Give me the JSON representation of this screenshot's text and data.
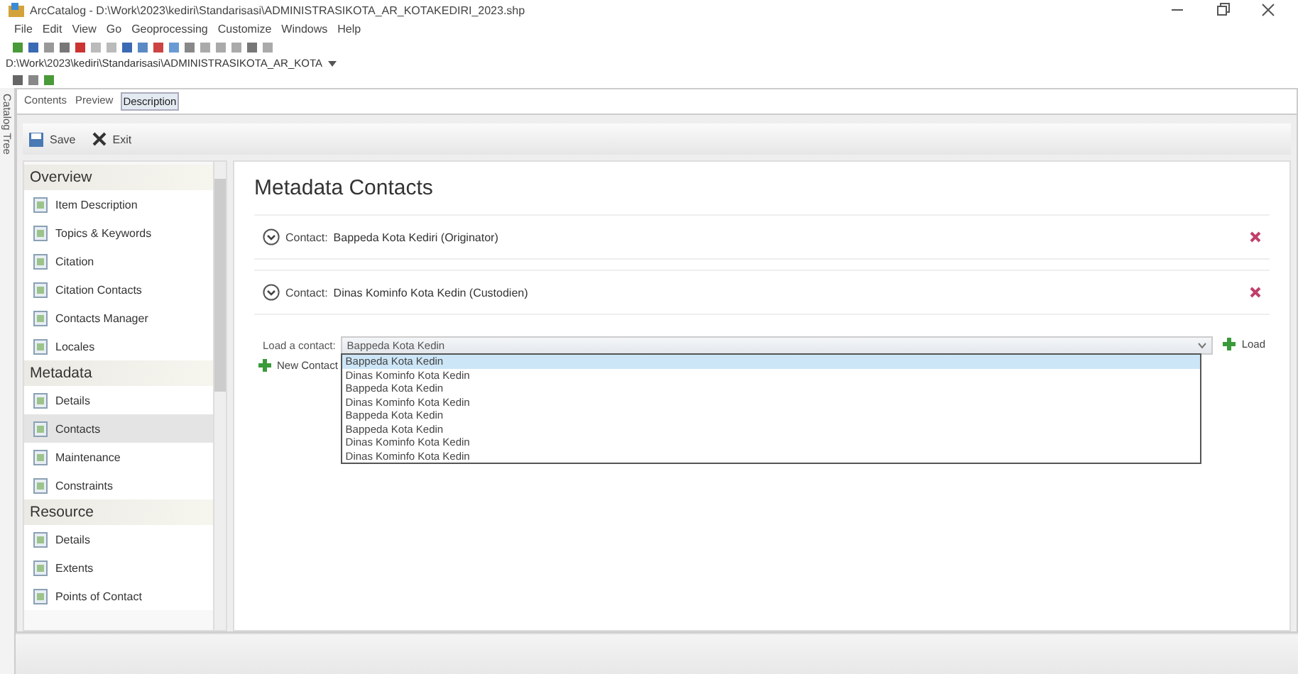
{
  "window": {
    "title": "ArcCatalog - D:\\Work\\2023\\kediri\\Standarisasi\\ADMINISTRASIKOTA_AR_KOTAKEDIRI_2023.shp"
  },
  "menu": [
    "File",
    "Edit",
    "View",
    "Go",
    "Geoprocessing",
    "Customize",
    "Windows",
    "Help"
  ],
  "location": {
    "value": "D:\\Work\\2023\\kediri\\Standarisasi\\ADMINISTRASIKOTA_AR_KOTA"
  },
  "side_tab": "Catalog Tree",
  "tabs": [
    {
      "label": "Contents",
      "selected": false
    },
    {
      "label": "Preview",
      "selected": false
    },
    {
      "label": "Description",
      "selected": true
    }
  ],
  "actions": [
    "Save",
    "Exit"
  ],
  "sidebar": [
    {
      "heading": "Overview",
      "items": [
        {
          "label": "Item Description",
          "selected": false
        },
        {
          "label": "Topics & Keywords",
          "selected": false
        },
        {
          "label": "Citation",
          "selected": false
        },
        {
          "label": "Citation Contacts",
          "selected": false
        },
        {
          "label": "Contacts Manager",
          "selected": false
        },
        {
          "label": "Locales",
          "selected": false
        }
      ]
    },
    {
      "heading": "Metadata",
      "items": [
        {
          "label": "Details",
          "selected": false
        },
        {
          "label": "Contacts",
          "selected": true
        },
        {
          "label": "Maintenance",
          "selected": false
        },
        {
          "label": "Constraints",
          "selected": false
        }
      ]
    },
    {
      "heading": "Resource",
      "items": [
        {
          "label": "Details",
          "selected": false
        },
        {
          "label": "Extents",
          "selected": false
        },
        {
          "label": "Points of Contact",
          "selected": false
        }
      ]
    }
  ],
  "page_title": "Metadata Contacts",
  "contacts": [
    {
      "label": "Contact:",
      "name": "Bappeda Kota Kediri (Originator)"
    },
    {
      "label": "Contact:",
      "name": "Dinas Kominfo Kota Kedin (Custodien)"
    }
  ],
  "load": {
    "label": "Load a contact:",
    "value": "Bappeda Kota Kedin",
    "button": "Load",
    "options": [
      {
        "label": "Bappeda Kota Kedin",
        "highlighted": true
      },
      {
        "label": "Dinas Kominfo Kota Kedin",
        "highlighted": false
      },
      {
        "label": "Bappeda Kota Kedin",
        "highlighted": false
      },
      {
        "label": "Dinas Kominfo Kota Kedin",
        "highlighted": false
      },
      {
        "label": "Bappeda Kota Kedin",
        "highlighted": false
      },
      {
        "label": "Bappeda Kota Kedin",
        "highlighted": false
      },
      {
        "label": "Dinas Kominfo Kota Kedin",
        "highlighted": false
      },
      {
        "label": "Dinas Kominfo Kota Kedin",
        "highlighted": false
      }
    ]
  },
  "new_contact": "New Contact"
}
